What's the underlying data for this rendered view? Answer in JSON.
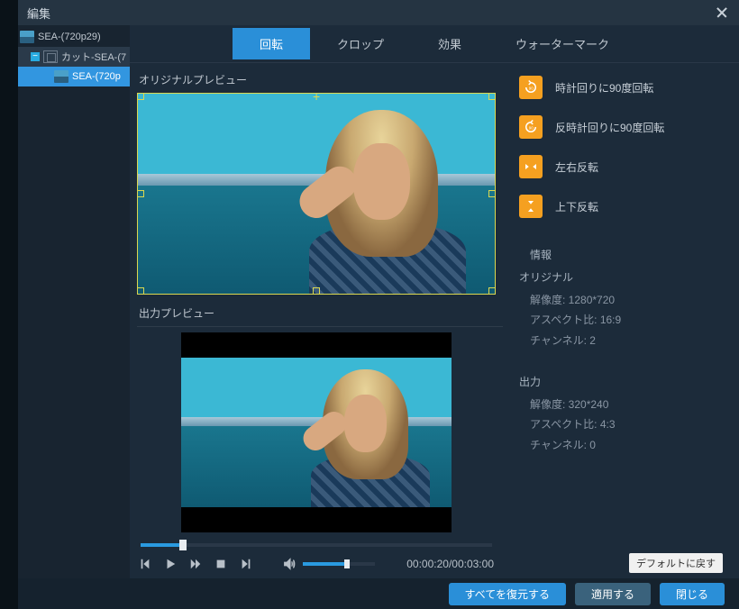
{
  "titlebar": {
    "title": "編集"
  },
  "tree": {
    "item0": "SEA-(720p29)",
    "item1": "カット-SEA-(7",
    "item2": "SEA-(720p"
  },
  "tabs": {
    "t0": "回転",
    "t1": "クロップ",
    "t2": "効果",
    "t3": "ウォーターマーク"
  },
  "preview": {
    "original_label": "オリジナルプレビュー",
    "output_label": "出力プレビュー"
  },
  "rotate": {
    "r0": "時計回りに90度回転",
    "r1": "反時計回りに90度回転",
    "r2": "左右反転",
    "r3": "上下反転"
  },
  "info": {
    "heading": "情報",
    "original_heading": "オリジナル",
    "output_heading": "出力",
    "orig_res": "解像度: 1280*720",
    "orig_aspect": "アスペクト比: 16:9",
    "orig_channel": "チャンネル: 2",
    "out_res": "解像度: 320*240",
    "out_aspect": "アスペクト比: 4:3",
    "out_channel": "チャンネル: 0"
  },
  "player": {
    "time": "00:00:20/00:03:00"
  },
  "buttons": {
    "default": "デフォルトに戻す",
    "restore_all": "すべてを復元する",
    "apply": "適用する",
    "close": "閉じる"
  }
}
